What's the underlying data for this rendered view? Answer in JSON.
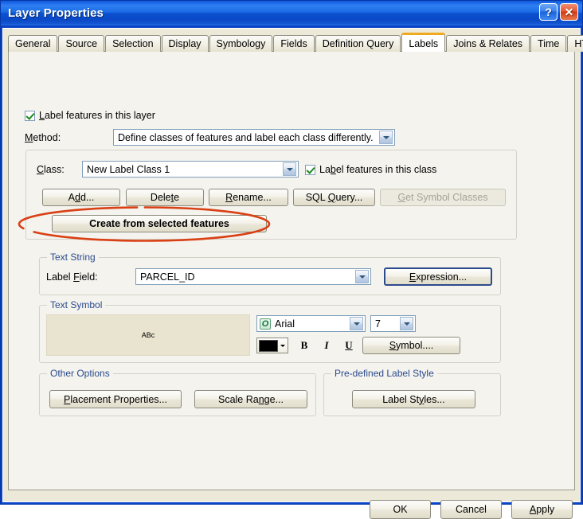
{
  "window": {
    "title": "Layer Properties",
    "help_button": "?",
    "close_button": "✕"
  },
  "tabs": [
    {
      "label": "General",
      "active": false
    },
    {
      "label": "Source",
      "active": false
    },
    {
      "label": "Selection",
      "active": false
    },
    {
      "label": "Display",
      "active": false
    },
    {
      "label": "Symbology",
      "active": false
    },
    {
      "label": "Fields",
      "active": false
    },
    {
      "label": "Definition Query",
      "active": false
    },
    {
      "label": "Labels",
      "active": true
    },
    {
      "label": "Joins & Relates",
      "active": false
    },
    {
      "label": "Time",
      "active": false
    },
    {
      "label": "HTML Popup",
      "active": false
    }
  ],
  "labels_tab": {
    "label_features_layer": {
      "text": "Label features in this layer",
      "checked": true
    },
    "method": {
      "label": "Method:",
      "value": "Define classes of features and label each class differently."
    },
    "class_group": {
      "class_label": "Class:",
      "class_value": "New Label Class 1",
      "label_features_class": {
        "text": "Label features in this class",
        "checked": true
      },
      "buttons": {
        "add": "Add...",
        "delete": "Delete",
        "rename": "Rename...",
        "sql_query": "SQL Query...",
        "get_symbol_classes": "Get Symbol Classes",
        "create_from_selected": "Create from selected features"
      }
    },
    "text_string": {
      "title": "Text String",
      "label_field_label": "Label Field:",
      "label_field_value": "PARCEL_ID",
      "expression_button": "Expression..."
    },
    "text_symbol": {
      "title": "Text Symbol",
      "preview_text": "ABc",
      "font_family": "Arial",
      "font_size": "7",
      "font_icon": "O",
      "color_hex": "#000000",
      "bold": "B",
      "italic": "I",
      "underline": "U",
      "symbol_button": "Symbol...."
    },
    "other_options": {
      "title": "Other Options",
      "placement_properties": "Placement Properties...",
      "scale_range": "Scale Range..."
    },
    "predefined_label_style": {
      "title": "Pre-defined Label Style",
      "label_styles": "Label Styles..."
    }
  },
  "dialog_buttons": {
    "ok": "OK",
    "cancel": "Cancel",
    "apply": "Apply"
  },
  "annotation": {
    "shape": "ellipse-highlight",
    "color": "#d94014",
    "targets": "create-from-selected-features-button"
  },
  "colors": {
    "titlebar_blue": "#0a44c8",
    "active_tab_accent": "#f0a91e",
    "group_title_blue": "#2a4b8d",
    "dialog_face": "#ece9d8",
    "panel_face": "#f4f3ee",
    "preview_face": "#e8e4d0",
    "annotation_red": "#d94014"
  }
}
